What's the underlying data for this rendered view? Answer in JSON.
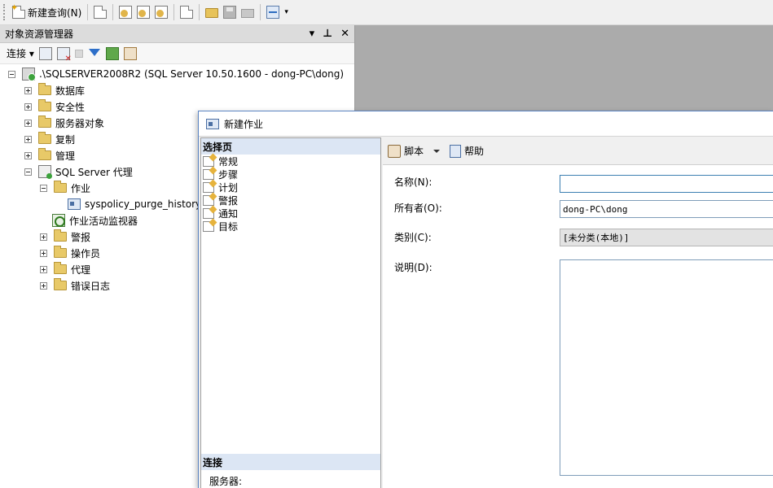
{
  "toolbar": {
    "new_query_label": "新建查询(N)",
    "icons": [
      "new-query-icon",
      "new-file-icon",
      "mdx-query-icon",
      "dmx-query-icon",
      "xmla-query-icon",
      "new-query2-icon",
      "open-file-icon",
      "save-icon",
      "print-icon",
      "activity-monitor-icon"
    ]
  },
  "object_explorer": {
    "title": "对象资源管理器",
    "connect_label": "连接",
    "tree": {
      "server": ".\\SQLSERVER2008R2 (SQL Server 10.50.1600 - dong-PC\\dong)",
      "databases": "数据库",
      "security": "安全性",
      "server_objects": "服务器对象",
      "replication": "复制",
      "management": "管理",
      "agent": "SQL Server 代理",
      "jobs": "作业",
      "job_item": "syspolicy_purge_history",
      "job_activity_monitor": "作业活动监视器",
      "alerts": "警报",
      "operators": "操作员",
      "proxies": "代理",
      "error_logs": "错误日志"
    }
  },
  "dialog": {
    "title": "新建作业",
    "select_page_header": "选择页",
    "pages": [
      "常规",
      "步骤",
      "计划",
      "警报",
      "通知",
      "目标"
    ],
    "connection_header": "连接",
    "server_label": "服务器:",
    "toolbar": {
      "script_label": "脚本",
      "help_label": "帮助"
    },
    "form": {
      "name_label": "名称(N):",
      "name_value": "",
      "owner_label": "所有者(O):",
      "owner_value": "dong-PC\\dong",
      "category_label": "类别(C):",
      "category_value": "[未分类(本地)]",
      "description_label": "说明(D):",
      "description_value": ""
    }
  }
}
